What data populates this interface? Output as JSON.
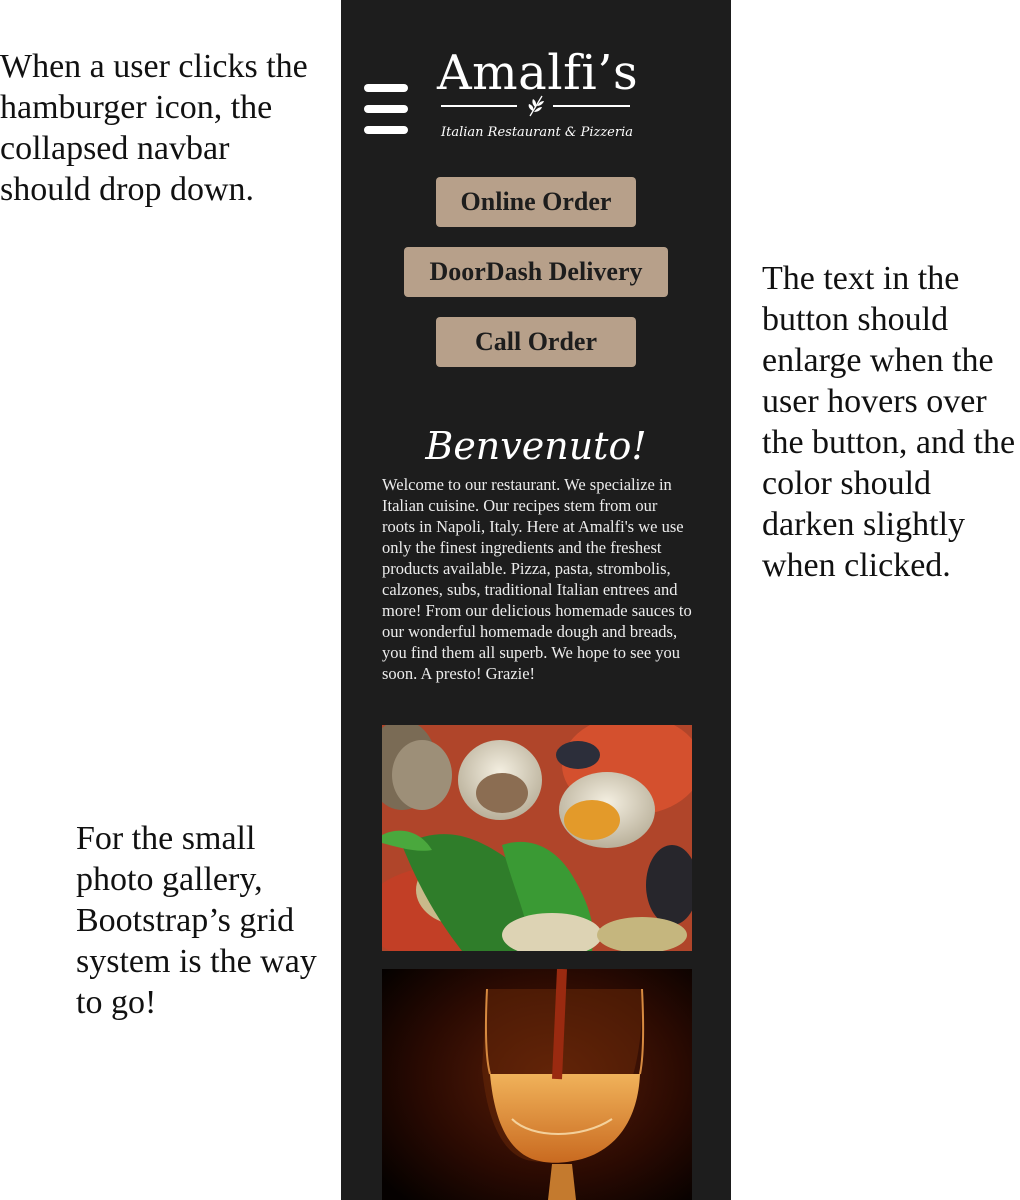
{
  "annotations": {
    "navbar_note": "When a user clicks the hamburger icon, the collapsed navbar should drop down.",
    "button_note": "The text in the button should enlarge when the user hovers over the button, and the color should darken slightly when clicked.",
    "gallery_note": "For the small photo gallery, Bootstrap’s grid system is the way to go!"
  },
  "navbar": {
    "menu_icon": "hamburger-icon",
    "logo": {
      "title": "Amalfi’s",
      "subtitle": "Italian Restaurant & Pizzeria",
      "ornament_icon": "leaf-icon"
    }
  },
  "buttons": {
    "online_order": "Online Order",
    "doordash_delivery": "DoorDash Delivery",
    "call_order": "Call Order"
  },
  "welcome": {
    "heading": "Benvenuto!",
    "body": "Welcome to our restaurant. We specialize in Italian cuisine. Our recipes stem from our roots in Napoli, Italy.  Here at Amalfi's we use only the finest ingredients and the freshest products available.  Pizza, pasta, strombolis, calzones, subs, traditional Italian entrees and more! From our delicious homemade sauces to our wonderful homemade dough and breads, you find them all superb.  We hope to see you soon.  A presto!  Grazie!"
  },
  "gallery": {
    "photos": [
      "clams-and-mussels-dish",
      "glass-of-wine"
    ]
  },
  "colors": {
    "page_background": "#ffffff",
    "mockup_background": "#1d1d1d",
    "button_background": "#b7a08a",
    "button_text": "#1d1d1d",
    "text_light": "#ffffff"
  }
}
